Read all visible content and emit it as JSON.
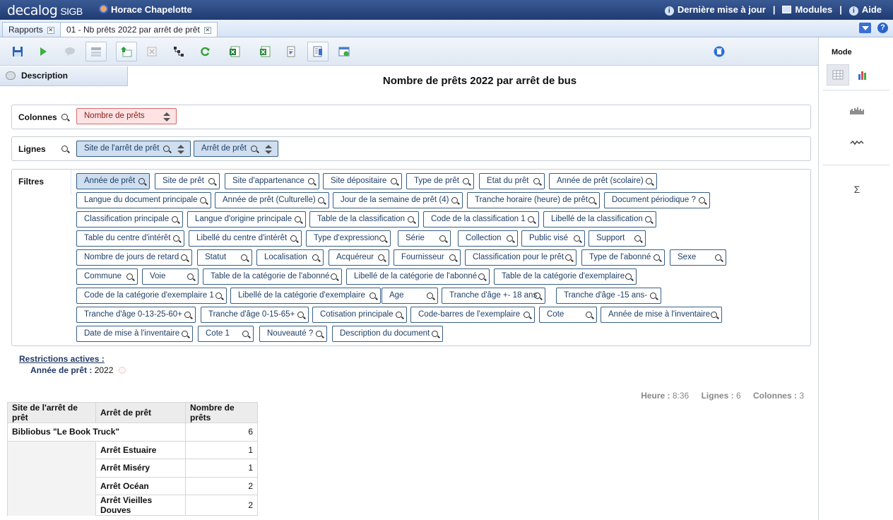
{
  "app": {
    "brand": "decalog",
    "product": "SIGB",
    "user": "Horace Chapelotte"
  },
  "topnav": {
    "update": "Dernière mise à jour",
    "modules": "Modules",
    "help": "Aide"
  },
  "tabs": [
    {
      "label": "Rapports"
    },
    {
      "label": "01 - Nb prêts 2022 par arrêt de prêt"
    }
  ],
  "toolbar": {
    "buttons": [
      "save-icon",
      "run-icon",
      "comment-icon",
      "layout-icon",
      "export-up-icon",
      "grid-clear-icon",
      "hierarchy-icon",
      "refresh-icon",
      "excel-icon",
      "excel-alt-icon",
      "document-icon",
      "print-preview-icon",
      "calendar-table-icon",
      "trash-icon"
    ]
  },
  "right_panel": {
    "mode_label": "Mode",
    "sigma": "Σ"
  },
  "description_label": "Description",
  "report_title": "Nombre de prêts 2022 par arrêt de bus",
  "panels": {
    "colonnes": {
      "label": "Colonnes",
      "chips": [
        "Nombre de prêts"
      ]
    },
    "lignes": {
      "label": "Lignes",
      "chips": [
        "Site de l'arrêt de prêt",
        "Arrêt de prêt"
      ]
    },
    "filtres": {
      "label": "Filtres",
      "chips": [
        "Année de prêt",
        "Site de prêt",
        "Site d'appartenance",
        "Site dépositaire",
        "Type de prêt",
        "Etat du prêt",
        "Année de prêt (scolaire)",
        "Langue du document principale",
        "Année de prêt (Culturelle)",
        "Jour de la semaine de prêt (4)",
        "Tranche horaire (heure) de prêt",
        "Document périodique ?",
        "Classification principale",
        "Langue d'origine principale",
        "Table de la classification",
        "Code de la classification 1",
        "Libellé de la classification",
        "Table du centre d'intérêt",
        "Libellé du centre d'intérêt",
        "Type d'expression",
        "Série",
        "Collection",
        "Public visé",
        "Support",
        "Nombre de jours de retard",
        "Statut",
        "Localisation",
        "Acquéreur",
        "Fournisseur",
        "Classification pour le prêt",
        "Type de l'abonné",
        "Sexe",
        "Commune",
        "Voie",
        "Table de la catégorie de l'abonné",
        "Libellé de la catégorie de l'abonné",
        "Table de la catégorie d'exemplaire",
        "Code de la catégorie d'exemplaire 1",
        "Libellé de la catégorie d'exemplaire",
        "Age",
        "Tranche d'âge +- 18 ans",
        "Tranche d'âge -15 ans-",
        "Tranche d'âge 0-13-25-60+",
        "Tranche d'âge 0-15-65+",
        "Cotisation principale",
        "Code-barres de l'exemplaire",
        "Cote",
        "Année de mise à l'inventaire",
        "Date de mise à l'inventaire",
        "Cote 1",
        "Nouveauté ?",
        "Description du document"
      ]
    }
  },
  "restrictions": {
    "title": "Restrictions actives :",
    "key": "Année de prêt :",
    "value": "2022"
  },
  "stats": {
    "heure_label": "Heure :",
    "heure": "8:36",
    "lignes_label": "Lignes :",
    "lignes": "6",
    "colonnes_label": "Colonnes :",
    "colonnes": "3"
  },
  "table": {
    "headers": [
      "Site de l'arrêt de prêt",
      "Arrêt de prêt",
      "Nombre de prêts"
    ],
    "rows": [
      {
        "site": "Bibliobus \"Le Book Truck\"",
        "arret": "",
        "nb": "6"
      },
      {
        "site": "",
        "arret": "Arrêt Estuaire",
        "nb": "1"
      },
      {
        "site": "",
        "arret": "Arrêt Miséry",
        "nb": "1"
      },
      {
        "site": "",
        "arret": "Arrêt Océan",
        "nb": "2"
      },
      {
        "site": "",
        "arret": "Arrêt Vieilles Douves",
        "nb": "2"
      }
    ]
  }
}
